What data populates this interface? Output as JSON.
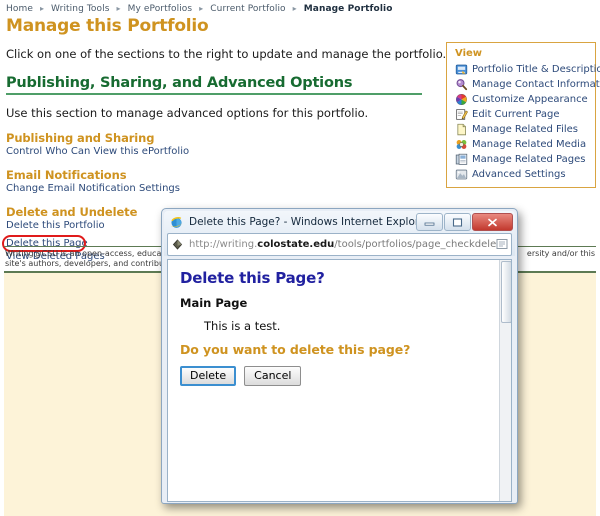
{
  "breadcrumb": {
    "items": [
      {
        "label": "Home",
        "current": false
      },
      {
        "label": "Writing Tools",
        "current": false
      },
      {
        "label": "My ePortfolios",
        "current": false
      },
      {
        "label": "Current Portfolio",
        "current": false
      },
      {
        "label": "Manage Portfolio",
        "current": true
      }
    ],
    "separator": "▸"
  },
  "page": {
    "title": "Manage this Portfolio",
    "intro": "Click on one of the sections to the right to update and manage the portfolio.",
    "section_title": "Publishing, Sharing, and Advanced Options",
    "section_intro": "Use this section to manage advanced options for this portfolio.",
    "subsections": [
      {
        "heading": "Publishing and Sharing",
        "links": [
          "Control Who Can View this ePortfolio"
        ]
      },
      {
        "heading": "Email Notifications",
        "links": [
          "Change Email Notification Settings"
        ]
      },
      {
        "heading": "Delete and Undelete",
        "links": [
          "Delete this Portfolio",
          "Delete this Page",
          "View Deleted Pages"
        ]
      }
    ],
    "annotated_link": "Delete this Page",
    "annotation_color": "#e01b1b"
  },
  "view_panel": {
    "title": "View",
    "border_color": "#d9a441",
    "items": [
      {
        "label": "Portfolio Title & Description",
        "icon": "portfolio-title-icon"
      },
      {
        "label": "Manage Contact Information",
        "icon": "magnifier-icon"
      },
      {
        "label": "Customize Appearance",
        "icon": "color-wheel-icon"
      },
      {
        "label": "Edit Current Page",
        "icon": "pencil-edit-icon"
      },
      {
        "label": "Manage Related Files",
        "icon": "file-icon"
      },
      {
        "label": "Manage Related Media",
        "icon": "media-flower-icon"
      },
      {
        "label": "Manage Related Pages",
        "icon": "pages-icon"
      },
      {
        "label": "Advanced Settings",
        "icon": "advanced-settings-icon"
      }
    ]
  },
  "footer": {
    "line1": "Writing@CSU is an open-access, educational",
    "line1_right": "ersity and/or this",
    "line2": "site's authors, developers, and contributor"
  },
  "dialog": {
    "window_title": "Delete this Page? - Windows Internet Explorer",
    "address": {
      "protocol": "http://writing.",
      "domain": "colostate.edu",
      "path": "/tools/portfolios/page_checkdelete.cfm"
    },
    "window_buttons": {
      "minimize": "minimize-button",
      "maximize": "maximize-button",
      "close": "close-button"
    },
    "heading": "Delete this Page?",
    "page_name": "Main Page",
    "body_text": "This is a test.",
    "question": "Do you want to delete this page?",
    "confirm_label": "Delete",
    "cancel_label": "Cancel"
  },
  "colors": {
    "gold": "#cf9320",
    "green": "#176b31",
    "link_blue": "#2d4a7a",
    "dialog_heading": "#2121a0",
    "cream": "#fdf3d8"
  }
}
